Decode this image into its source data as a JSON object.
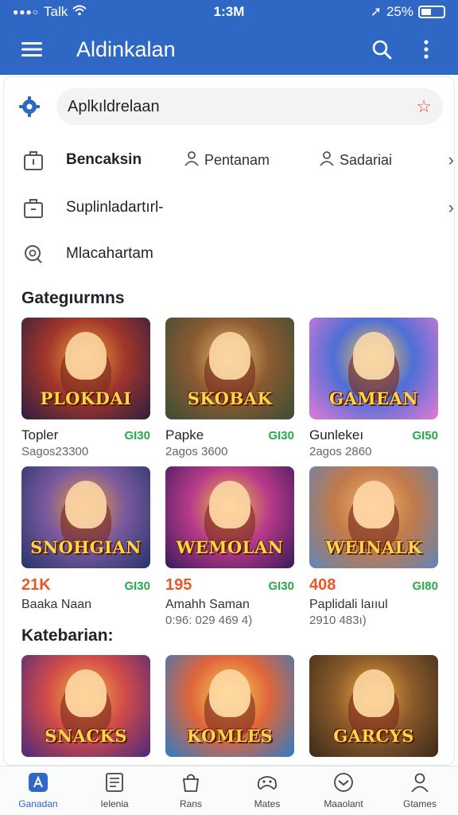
{
  "status": {
    "carrier": "Talk",
    "time": "1:3M",
    "battery": "25%"
  },
  "app_bar": {
    "title": "Aldinkalan"
  },
  "search": {
    "placeholder": "Aplkıldrelaan"
  },
  "menu": {
    "row1": {
      "label": "Bencaksin",
      "sub1": "Pentanam",
      "sub2": "Sadariai"
    },
    "row2": {
      "label": "Suplinladartırl-"
    },
    "row3": {
      "label": "Mlacahartam"
    }
  },
  "sections": {
    "categories_title": "Gategıurmns",
    "second_title": "Katebarian:"
  },
  "cards_row1": [
    {
      "art": "PLOKDAI",
      "title": "Topler",
      "badge": "GI30",
      "sub": "Sagos23300",
      "colors": [
        "#2b1e3f",
        "#a2362b",
        "#f0a13a"
      ]
    },
    {
      "art": "SKOBAK",
      "title": "Papke",
      "badge": "GI30",
      "sub": "2agos 3600",
      "colors": [
        "#3b4d34",
        "#8a5a32",
        "#e9b86b"
      ]
    },
    {
      "art": "GAMEAN",
      "title": "Gunlekeı",
      "badge": "GI50",
      "sub": "2agos 2860",
      "colors": [
        "#e37ad4",
        "#4e6fd6",
        "#f3c35b"
      ]
    }
  ],
  "cards_row2": [
    {
      "art": "SNOHGIAN",
      "value": "21K",
      "badge": "GI30",
      "title": "Baaka Naan",
      "sub": "",
      "colors": [
        "#24336b",
        "#7a5a9e",
        "#f09a3e"
      ]
    },
    {
      "art": "WEMOLAN",
      "value": "195",
      "badge": "GI30",
      "title": "Amahh Saman",
      "sub": "0:96: 029 469 4)",
      "colors": [
        "#3a1a5a",
        "#b83a8a",
        "#f0c040"
      ]
    },
    {
      "art": "WEINALK",
      "value": "408",
      "badge": "GI80",
      "title": "Paplidali laııul",
      "sub": "2910 483ı)",
      "colors": [
        "#5f86b8",
        "#c27a4a",
        "#f3b36a"
      ]
    }
  ],
  "cards_row3": [
    {
      "art": "SNACKS",
      "colors": [
        "#4a2a7a",
        "#d14a4a",
        "#f5b33a"
      ]
    },
    {
      "art": "KOMLES",
      "colors": [
        "#2e7bc7",
        "#e0653a",
        "#f7d35a"
      ]
    },
    {
      "art": "GARCYS",
      "colors": [
        "#3a2a1a",
        "#8a5a2a",
        "#f0a83a"
      ]
    }
  ],
  "bottom_nav": [
    {
      "label": "Ganadan",
      "icon": "app-store-icon",
      "active": true
    },
    {
      "label": "Ielenia",
      "icon": "list-icon",
      "active": false
    },
    {
      "label": "Rans",
      "icon": "bag-icon",
      "active": false
    },
    {
      "label": "Mates",
      "icon": "gamepad-icon",
      "active": false
    },
    {
      "label": "Maaolant",
      "icon": "download-icon",
      "active": false
    },
    {
      "label": "Gtames",
      "icon": "person-icon",
      "active": false
    }
  ],
  "accent": "#2f67c4"
}
